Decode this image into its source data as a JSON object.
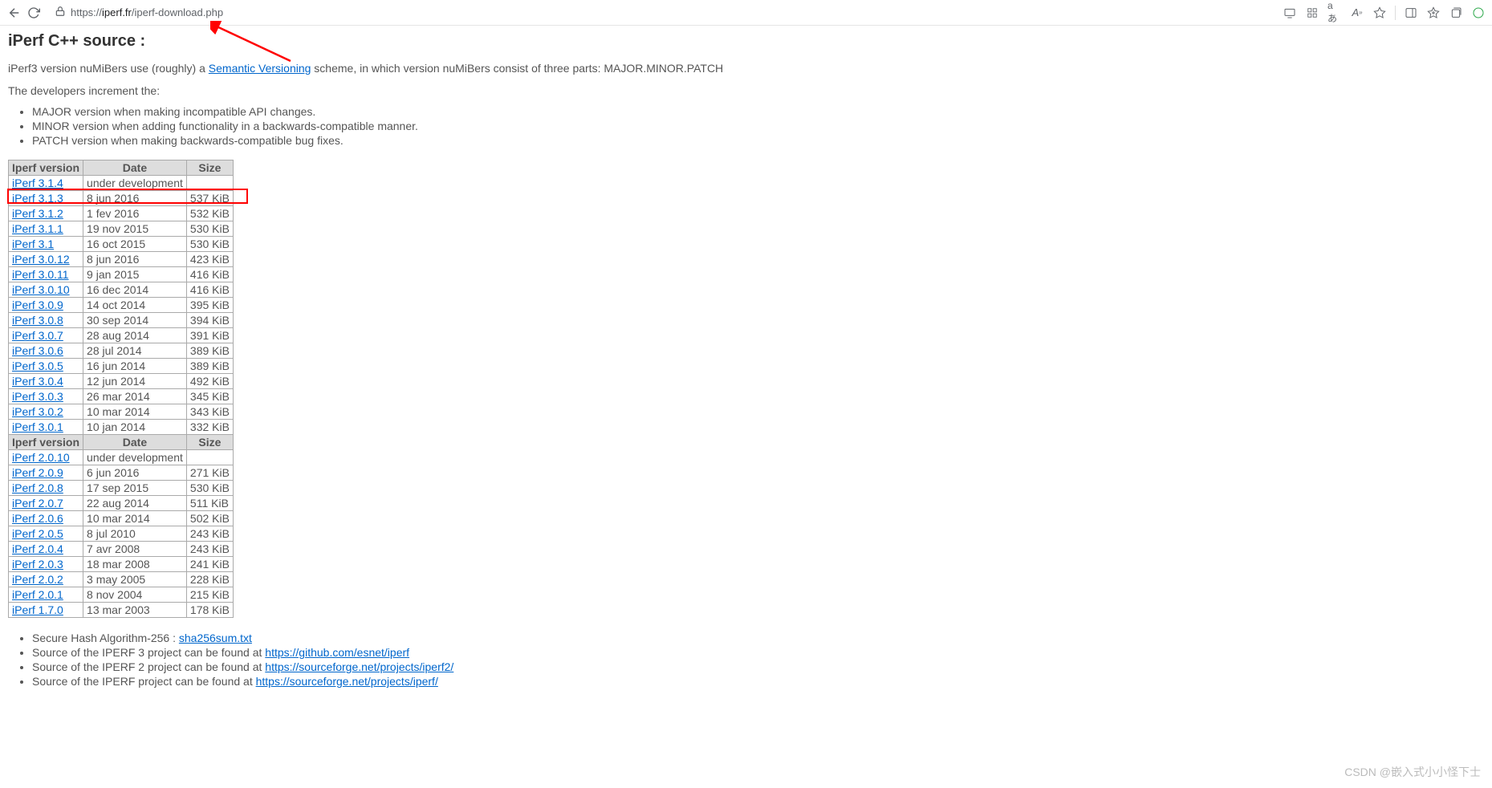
{
  "browser": {
    "url_prefix": "https://",
    "url_host": "iperf.fr",
    "url_path": "/iperf-download.php"
  },
  "page_title": "iPerf C++ source :",
  "intro_pre": "iPerf3 version nuMiBers use (roughly) a ",
  "intro_link": "Semantic Versioning",
  "intro_post": " scheme, in which version nuMiBers consist of three parts: MAJOR.MINOR.PATCH",
  "leadin": "The developers increment the:",
  "bullets": [
    "MAJOR version when making incompatible API changes.",
    "MINOR version when adding functionality in a backwards-compatible manner.",
    "PATCH version when making backwards-compatible bug fixes."
  ],
  "table": {
    "headers": [
      "Iperf version",
      "Date",
      "Size"
    ],
    "rows1": [
      {
        "version": "iPerf 3.1.4",
        "date": "under development",
        "size": ""
      },
      {
        "version": "iPerf 3.1.3",
        "date": "8 jun 2016",
        "size": "537 KiB"
      },
      {
        "version": "iPerf 3.1.2",
        "date": "1 fev 2016",
        "size": "532 KiB"
      },
      {
        "version": "iPerf 3.1.1",
        "date": "19 nov 2015",
        "size": "530 KiB"
      },
      {
        "version": "iPerf 3.1",
        "date": "16 oct 2015",
        "size": "530 KiB"
      },
      {
        "version": "iPerf 3.0.12",
        "date": "8 jun 2016",
        "size": "423 KiB"
      },
      {
        "version": "iPerf 3.0.11",
        "date": "9 jan 2015",
        "size": "416 KiB"
      },
      {
        "version": "iPerf 3.0.10",
        "date": "16 dec 2014",
        "size": "416 KiB"
      },
      {
        "version": "iPerf 3.0.9",
        "date": "14 oct 2014",
        "size": "395 KiB"
      },
      {
        "version": "iPerf 3.0.8",
        "date": "30 sep 2014",
        "size": "394 KiB"
      },
      {
        "version": "iPerf 3.0.7",
        "date": "28 aug 2014",
        "size": "391 KiB"
      },
      {
        "version": "iPerf 3.0.6",
        "date": "28 jul 2014",
        "size": "389 KiB"
      },
      {
        "version": "iPerf 3.0.5",
        "date": "16 jun 2014",
        "size": "389 KiB"
      },
      {
        "version": "iPerf 3.0.4",
        "date": "12 jun 2014",
        "size": "492 KiB"
      },
      {
        "version": "iPerf 3.0.3",
        "date": "26 mar 2014",
        "size": "345 KiB"
      },
      {
        "version": "iPerf 3.0.2",
        "date": "10 mar 2014",
        "size": "343 KiB"
      },
      {
        "version": "iPerf 3.0.1",
        "date": "10 jan 2014",
        "size": "332 KiB"
      }
    ],
    "rows2": [
      {
        "version": "iPerf 2.0.10",
        "date": "under development",
        "size": ""
      },
      {
        "version": "iPerf 2.0.9",
        "date": "6 jun 2016",
        "size": "271 KiB"
      },
      {
        "version": "iPerf 2.0.8",
        "date": "17 sep 2015",
        "size": "530 KiB"
      },
      {
        "version": "iPerf 2.0.7",
        "date": "22 aug 2014",
        "size": "511 KiB"
      },
      {
        "version": "iPerf 2.0.6",
        "date": "10 mar 2014",
        "size": "502 KiB"
      },
      {
        "version": "iPerf 2.0.5",
        "date": "8 jul 2010",
        "size": "243 KiB"
      },
      {
        "version": "iPerf 2.0.4",
        "date": "7 avr 2008",
        "size": "243 KiB"
      },
      {
        "version": "iPerf 2.0.3",
        "date": "18 mar 2008",
        "size": "241 KiB"
      },
      {
        "version": "iPerf 2.0.2",
        "date": "3 may 2005",
        "size": "228 KiB"
      },
      {
        "version": "iPerf 2.0.1",
        "date": "8 nov 2004",
        "size": "215 KiB"
      },
      {
        "version": "iPerf 1.7.0",
        "date": "13 mar 2003",
        "size": "178 KiB"
      }
    ]
  },
  "bottom_links": [
    {
      "pre": "Secure Hash Algorithm-256 : ",
      "link": "sha256sum.txt"
    },
    {
      "pre": "Source of the IPERF 3 project can be found at ",
      "link": "https://github.com/esnet/iperf"
    },
    {
      "pre": "Source of the IPERF 2 project can be found at ",
      "link": "https://sourceforge.net/projects/iperf2/"
    },
    {
      "pre": "Source of the IPERF project can be found at ",
      "link": "https://sourceforge.net/projects/iperf/"
    }
  ],
  "watermark": "CSDN @嵌入式小小怪下士"
}
